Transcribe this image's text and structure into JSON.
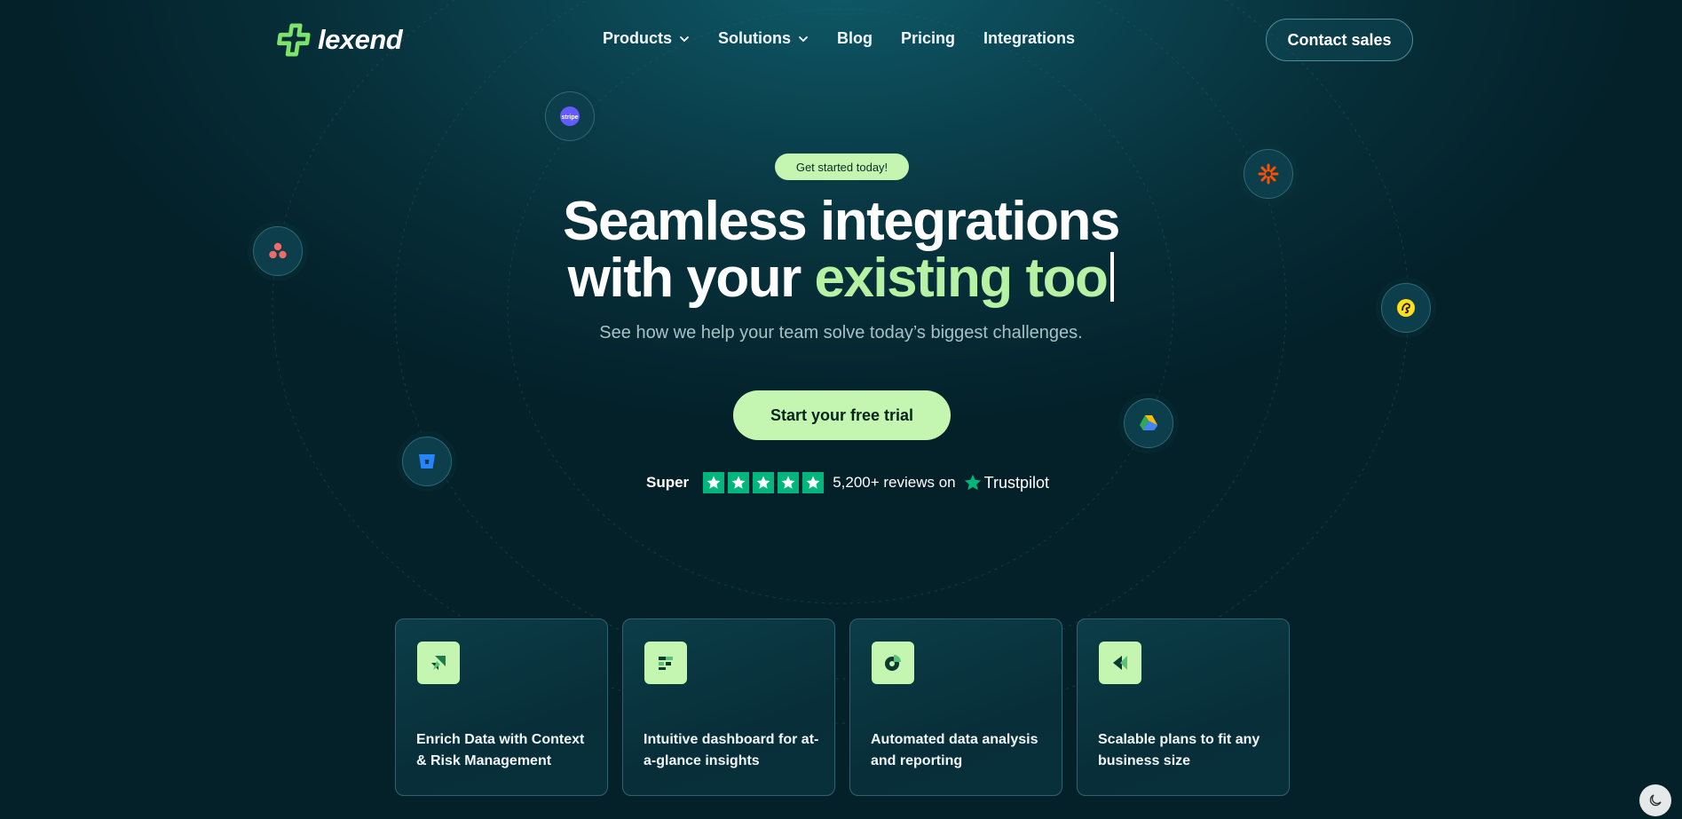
{
  "brand": {
    "name": "lexend"
  },
  "nav": {
    "items": [
      {
        "label": "Products",
        "has_dropdown": true
      },
      {
        "label": "Solutions",
        "has_dropdown": true
      },
      {
        "label": "Blog",
        "has_dropdown": false
      },
      {
        "label": "Pricing",
        "has_dropdown": false
      },
      {
        "label": "Integrations",
        "has_dropdown": false
      }
    ],
    "contact_label": "Contact sales"
  },
  "hero": {
    "badge": "Get started today!",
    "headline_line1": "Seamless integrations",
    "headline_line2_prefix": "with your ",
    "headline_line2_accent": "existing too",
    "subtitle": "See how we help your team solve today’s biggest challenges.",
    "cta_label": "Start your free trial",
    "rating_word": "Super",
    "rating_stars": 5,
    "reviews_text": "5,200+ reviews on",
    "trustpilot_label": "Trustpilot"
  },
  "floating_icons": [
    {
      "name": "stripe-icon",
      "color": "#635bff"
    },
    {
      "name": "zapier-icon",
      "color": "#ff4f00"
    },
    {
      "name": "asana-icon",
      "color": "#f06a6a"
    },
    {
      "name": "mailchimp-icon",
      "color": "#ffe01b"
    },
    {
      "name": "google-drive-icon",
      "color": "#4285f4"
    },
    {
      "name": "bitbucket-icon",
      "color": "#2684ff"
    }
  ],
  "cards": [
    {
      "title": "Enrich Data with Context & Risk Management",
      "icon": "enrich-icon"
    },
    {
      "title": "Intuitive dashboard for at-a-glance insights",
      "icon": "dashboard-icon"
    },
    {
      "title": "Automated data analysis and reporting",
      "icon": "pie-chart-icon"
    },
    {
      "title": "Scalable plans to fit any business size",
      "icon": "scale-icon"
    }
  ],
  "colors": {
    "accent": "#c4f6b1",
    "accent_text": "#b7f2a4",
    "trustpilot": "#00b67a",
    "background": "#07303a"
  },
  "theme_toggle": {
    "icon": "moon-icon"
  }
}
